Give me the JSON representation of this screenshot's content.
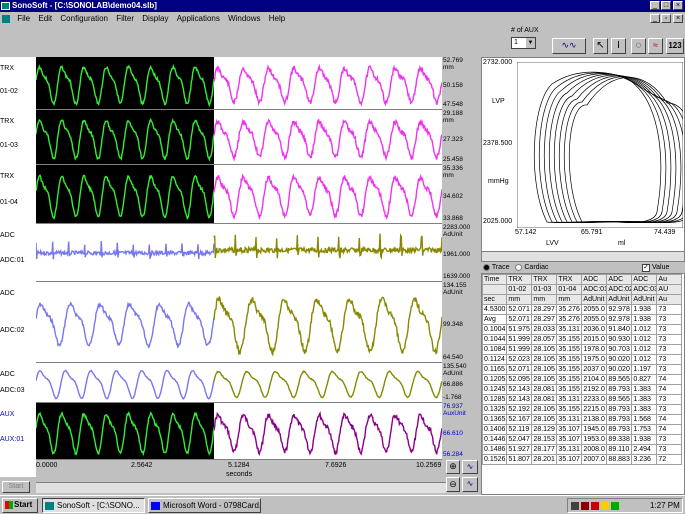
{
  "window": {
    "title": "SonoSoft - [C:\\SONOLAB\\demo04.slb]"
  },
  "menu": [
    "File",
    "Edit",
    "Configuration",
    "Filter",
    "Display",
    "Applications",
    "Windows",
    "Help"
  ],
  "toolbar": {
    "aux_label": "# of AUX",
    "aux_value": "1",
    "label_123": "123"
  },
  "channels": [
    {
      "name": "TRX",
      "sub": "01-02",
      "top": "52.769",
      "unit": "mm",
      "mid": "50.158",
      "bottom": "47.548",
      "left": "#33ee33",
      "right": "#ee33ee",
      "vals": [
        [
          3,
          15
        ],
        [
          7,
          5
        ],
        [
          11,
          15
        ],
        [
          15,
          5
        ],
        [
          19,
          15
        ],
        [
          23,
          5
        ],
        [
          27,
          16
        ],
        [
          31,
          5
        ],
        [
          35,
          15
        ],
        [
          39,
          5
        ],
        [
          43,
          15
        ],
        [
          47,
          5
        ],
        [
          51,
          15
        ]
      ]
    },
    {
      "name": "TRX",
      "sub": "01-03",
      "top": "29.188",
      "unit": "mm",
      "mid": "27.323",
      "bottom": "25.458"
    },
    {
      "name": "TRX",
      "sub": "01-04",
      "top": "35.336",
      "unit": "mm",
      "mid": "34.602",
      "bottom": "33.868"
    },
    {
      "name": "ADC",
      "sub": "ADC:01",
      "top": "2283.000",
      "unit": "AdUnit",
      "mid": "1961.000",
      "bottom": "1639.000"
    },
    {
      "name": "ADC",
      "sub": "ADC:02",
      "top": "134.155",
      "unit": "AdUnit",
      "mid": "99.348",
      "bottom": "64.540"
    },
    {
      "name": "ADC",
      "sub": "ADC:03",
      "top": "135.540",
      "unit": "AdUnit",
      "mid": "66.886",
      "bottom": "-1.768"
    },
    {
      "name": "AUX",
      "sub": "AUX:01",
      "top": "76.937",
      "unit": "AuxUnit",
      "mid": "66.610",
      "bottom": "56.284"
    }
  ],
  "xaxis": {
    "ticks": [
      "0.0000",
      "2.5642",
      "5.1284",
      "7.6926",
      "10.2569"
    ],
    "label": "seconds"
  },
  "start_label": "Start",
  "loop": {
    "y_top": "2732.000",
    "y_mid": "2378.500",
    "y_bot": "2025.000",
    "ylabel": "LVP",
    "yunit": "mmHg",
    "x_ticks": [
      "57.142",
      "65.791",
      "74.439"
    ],
    "xlabel": "LVV",
    "xunit": "ml"
  },
  "grid_opts": {
    "trace": "Trace",
    "cardiac": "Cardiac",
    "value": "Value"
  },
  "grid": {
    "header1": [
      "Time",
      "TRX",
      "TRX",
      "TRX",
      "ADC",
      "ADC",
      "ADC",
      "Au"
    ],
    "header2": [
      "",
      "01-02",
      "01-03",
      "01-04",
      "ADC:01",
      "ADC:02",
      "ADC:03",
      "AU"
    ],
    "header3": [
      "sec",
      "mm",
      "mm",
      "mm",
      "AdUnit",
      "AdUnit",
      "AdUnit",
      "Au"
    ],
    "rows": [
      [
        "4.5300",
        "52.071",
        "28.297",
        "35.276",
        "2055.0",
        "92.978",
        "1.938",
        "73"
      ],
      [
        "Avg",
        "52.071",
        "28.297",
        "35.276",
        "2055.0",
        "92.978",
        "1.938",
        "73"
      ],
      [
        "0.1004",
        "51.975",
        "28.033",
        "35.131",
        "2036.0",
        "91.840",
        "1.012",
        "73"
      ],
      [
        "0.1044",
        "51.999",
        "28.057",
        "35.155",
        "2015.0",
        "90.930",
        "1.012",
        "73"
      ],
      [
        "0.1084",
        "51.999",
        "28.105",
        "35.155",
        "1978.0",
        "90.703",
        "1.012",
        "73"
      ],
      [
        "0.1124",
        "52.023",
        "28.105",
        "35.155",
        "1975.0",
        "90.020",
        "1.012",
        "73"
      ],
      [
        "0.1165",
        "52.071",
        "28.105",
        "35.155",
        "2037.0",
        "90.020",
        "1.197",
        "73"
      ],
      [
        "0.1205",
        "52.095",
        "28.105",
        "35.155",
        "2104.0",
        "89.565",
        "0.827",
        "74"
      ],
      [
        "0.1245",
        "52.143",
        "28.081",
        "35.155",
        "2192.0",
        "89.793",
        "1.383",
        "74"
      ],
      [
        "0.1285",
        "52.143",
        "28.081",
        "35.131",
        "2233.0",
        "89.565",
        "1.383",
        "73"
      ],
      [
        "0.1325",
        "52.192",
        "28.105",
        "35.155",
        "2215.0",
        "89.793",
        "1.383",
        "73"
      ],
      [
        "0.1365",
        "52.167",
        "28.105",
        "35.131",
        "2138.0",
        "89.793",
        "1.568",
        "74"
      ],
      [
        "0.1406",
        "52.119",
        "28.129",
        "35.107",
        "1945.0",
        "89.793",
        "1.753",
        "74"
      ],
      [
        "0.1446",
        "52.047",
        "28.153",
        "35.107",
        "1953.0",
        "89.338",
        "1.938",
        "73"
      ],
      [
        "0.1486",
        "51.927",
        "28.177",
        "35.131",
        "2008.0",
        "89.110",
        "2.494",
        "73"
      ],
      [
        "0.1526",
        "51.807",
        "28.201",
        "35.107",
        "2007.0",
        "88.883",
        "3.236",
        "72"
      ]
    ]
  },
  "taskbar": {
    "start": "Start",
    "tasks": [
      "SonoSoft - [C:\\SONO...",
      "Microsoft Word - 0798Card..."
    ],
    "clock": "1:27 PM"
  }
}
